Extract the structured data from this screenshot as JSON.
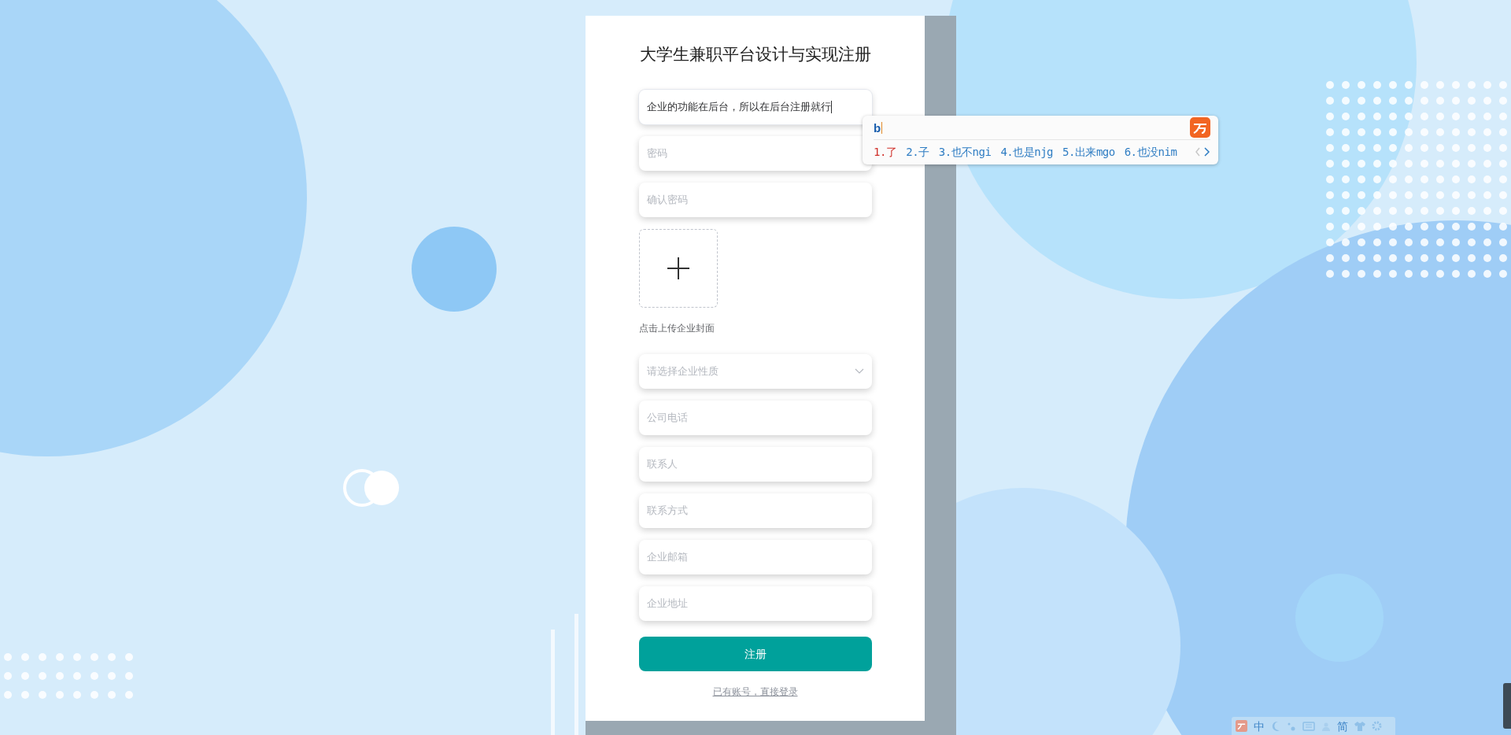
{
  "title": "大学生兼职平台设计与实现注册",
  "fields": [
    {
      "kind": "text",
      "value": "企业的功能在后台，所以在后台注册就行",
      "focused": true
    },
    {
      "kind": "password",
      "placeholder": "密码",
      "focused": false
    },
    {
      "kind": "password",
      "placeholder": "确认密码",
      "focused": false
    },
    {
      "kind": "upload",
      "caption": "点击上传企业封面"
    },
    {
      "kind": "select",
      "placeholder": "请选择企业性质",
      "focused": false
    },
    {
      "kind": "text",
      "placeholder": "公司电话",
      "focused": false
    },
    {
      "kind": "text",
      "placeholder": "联系人",
      "focused": false
    },
    {
      "kind": "text",
      "placeholder": "联系方式",
      "focused": false
    },
    {
      "kind": "text",
      "placeholder": "企业邮箱",
      "focused": false
    },
    {
      "kind": "text",
      "placeholder": "企业地址",
      "focused": false
    }
  ],
  "submit": "注册",
  "login_link": "已有账号，直接登录",
  "ime": {
    "input": "b",
    "candidates": [
      {
        "label": "1.了",
        "selected": true
      },
      {
        "label": "2.子",
        "selected": false
      },
      {
        "label": "3.也不ngi",
        "selected": false
      },
      {
        "label": "4.也是njg",
        "selected": false
      },
      {
        "label": "5.出来mgo",
        "selected": false
      },
      {
        "label": "6.也没nim",
        "selected": false
      }
    ]
  },
  "ime_toolbar": {
    "mode": "中",
    "script": "简"
  }
}
